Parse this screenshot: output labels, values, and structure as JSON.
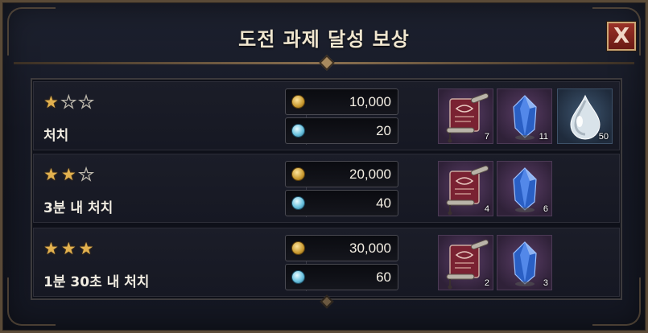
{
  "title": "도전 과제 달성 보상",
  "close_label": "X",
  "rows": [
    {
      "stars": [
        true,
        false,
        false
      ],
      "condition": "처치",
      "gold": "10,000",
      "crystal": "20",
      "items": [
        {
          "icon": "scroll-icon",
          "count": "7",
          "bg": "purple"
        },
        {
          "icon": "blue-gem-icon",
          "count": "11",
          "bg": "purple"
        },
        {
          "icon": "water-drop-icon",
          "count": "50",
          "bg": "blue"
        }
      ]
    },
    {
      "stars": [
        true,
        true,
        false
      ],
      "condition": "3분 내 처치",
      "gold": "20,000",
      "crystal": "40",
      "items": [
        {
          "icon": "scroll-icon",
          "count": "4",
          "bg": "purple"
        },
        {
          "icon": "blue-gem-icon",
          "count": "6",
          "bg": "purple"
        }
      ]
    },
    {
      "stars": [
        true,
        true,
        true
      ],
      "condition": "1분 30초 내 처치",
      "gold": "30,000",
      "crystal": "60",
      "items": [
        {
          "icon": "scroll-icon",
          "count": "2",
          "bg": "purple"
        },
        {
          "icon": "blue-gem-icon",
          "count": "3",
          "bg": "purple"
        }
      ]
    }
  ],
  "colors": {
    "star_on": "#e2b14f",
    "panel_border": "#5a4a37",
    "close_button": "#9a3228"
  }
}
